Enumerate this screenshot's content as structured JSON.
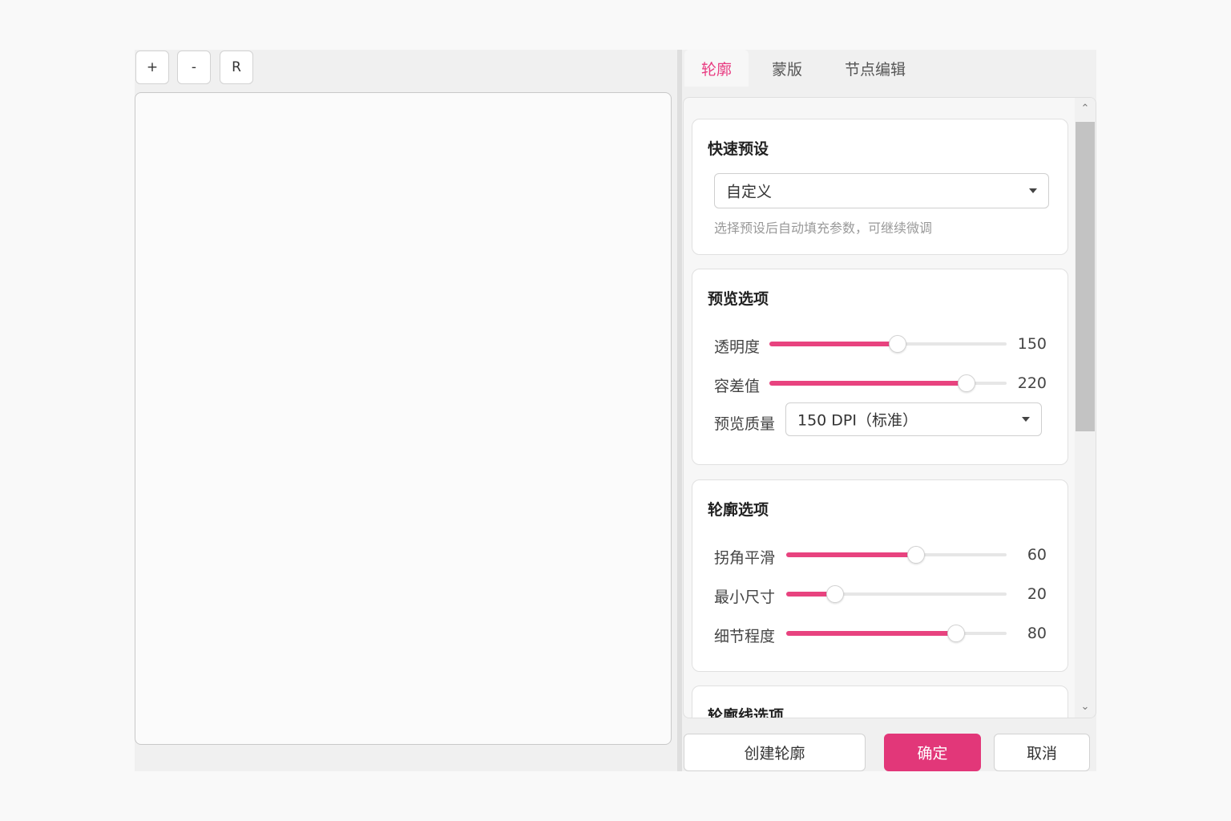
{
  "toolbar": {
    "zoom_in_label": "+",
    "zoom_out_label": "-",
    "reset_label": "R"
  },
  "tabs": [
    {
      "label": "轮廓",
      "active": true
    },
    {
      "label": "蒙版",
      "active": false
    },
    {
      "label": "节点编辑",
      "active": false
    }
  ],
  "preset": {
    "title": "快速预设",
    "selected": "自定义",
    "hint": "选择预设后自动填充参数，可继续微调"
  },
  "preview": {
    "title": "预览选项",
    "sliders": [
      {
        "label": "透明度",
        "value": "150",
        "fraction": 0.54
      },
      {
        "label": "容差值",
        "value": "220",
        "fraction": 0.83
      }
    ],
    "quality_label": "预览质量",
    "quality_selected": "150 DPI（标准）"
  },
  "contour": {
    "title": "轮廓选项",
    "sliders": [
      {
        "label": "拐角平滑",
        "value": "60",
        "fraction": 0.59
      },
      {
        "label": "最小尺寸",
        "value": "20",
        "fraction": 0.22
      },
      {
        "label": "细节程度",
        "value": "80",
        "fraction": 0.77
      }
    ]
  },
  "contour_line": {
    "title": "轮廓线选项"
  },
  "footer": {
    "create_label": "创建轮廓",
    "ok_label": "确定",
    "cancel_label": "取消"
  },
  "colors": {
    "accent": "#e8437f",
    "primary_button": "#e23779"
  }
}
